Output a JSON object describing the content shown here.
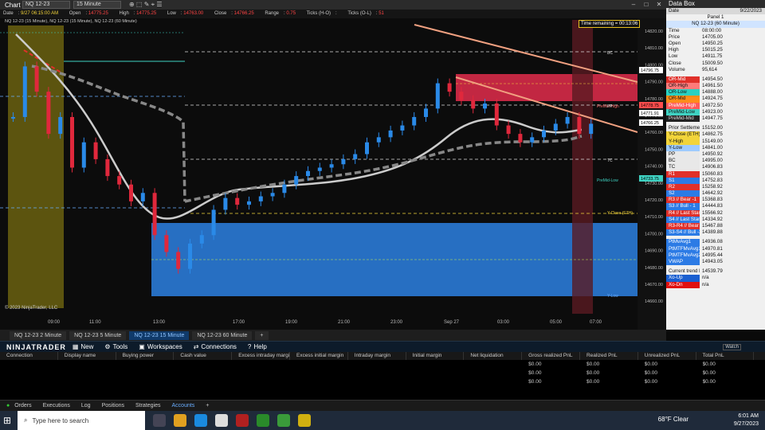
{
  "window": {
    "title": "Chart",
    "instrument": "NQ 12-23",
    "interval": "15 Minute"
  },
  "infobar": {
    "date_label": "Date",
    "date_value": "9/27 06:15:00 AM",
    "open_label": "Open",
    "open_value": "14775.25",
    "high_label": "High",
    "high_value": "14775.25",
    "low_label": "Low",
    "low_value": "14763.00",
    "close_label": "Close",
    "close_value": "14766.25",
    "range_label": "Range",
    "range_value": "0.75",
    "ticks_hl_label": "Ticks (H-O)",
    "ticks_hl_value": "",
    "ticks_ol_label": "Ticks (O-L)",
    "ticks_ol_value": "51"
  },
  "chart": {
    "legend_text": "NQ 12-23 (15 Minute), NQ 12-23 (15 Minute), NQ 12-23 (60 Minute)",
    "time_remaining": "Time remaining = 00:13:06",
    "copyright": "© 2023 NinjaTrader, LLC",
    "y_ticks": [
      "14820.00",
      "14810.00",
      "14800.00",
      "14790.00",
      "14780.00",
      "14770.00",
      "14760.00",
      "14750.00",
      "14740.00",
      "14730.00",
      "14720.00",
      "14710.00",
      "14700.00",
      "14690.00",
      "14680.00",
      "14670.00",
      "14660.00"
    ],
    "x_ticks": [
      "09:00",
      "11:00",
      "13:00",
      "17:00",
      "19:00",
      "21:00",
      "23:00",
      "Sep 27",
      "03:00",
      "05:00",
      "07:00"
    ],
    "price_tags": [
      {
        "value": "14796.75",
        "color": "#ffffff"
      },
      {
        "value": "14778.75",
        "color": "#ff4d4d"
      },
      {
        "value": "14771.91",
        "color": "#ffffff"
      },
      {
        "value": "14766.25",
        "color": "#ffffff"
      },
      {
        "value": "14733.75",
        "color": "#3fd2c2"
      }
    ],
    "level_labels": [
      {
        "text": "BC",
        "color": "#dddddd"
      },
      {
        "text": "PreMid-High",
        "color": "#ff6a6a"
      },
      {
        "text": "PP",
        "color": "#dddddd"
      },
      {
        "text": "TC",
        "color": "#dddddd"
      },
      {
        "text": "PreMid-Low",
        "color": "#3fd2c2"
      },
      {
        "text": "Y-Close (ETH)",
        "color": "#f2d43a"
      },
      {
        "text": "Y-Low",
        "color": "#6aaeff"
      }
    ]
  },
  "chart_data": {
    "type": "candlestick",
    "title": "NQ 12-23 (15 Minute)",
    "ylim": [
      14660,
      14825
    ],
    "xlabel": "",
    "ylabel": "",
    "levels": {
      "BC": 14806.0,
      "PP": 14778.0,
      "TC": 14747.0,
      "Y-Close": 14714.0,
      "PreMid-High": 14778.75,
      "PreMid-Low": 14733.75
    },
    "series": [
      {
        "name": "price",
        "values": [
          14770,
          14800,
          14785,
          14760,
          14770,
          14740,
          14755,
          14745,
          14735,
          14730,
          14720,
          14725,
          14700,
          14690,
          14680,
          14695,
          14700,
          14715,
          14722,
          14718,
          14720,
          14723,
          14725,
          14730,
          14735,
          14738,
          14740,
          14742,
          14745,
          14748,
          14755,
          14758,
          14762,
          14765,
          14770,
          14775,
          14790,
          14785,
          14780,
          14775,
          14778,
          14765,
          14760,
          14755,
          14758,
          14762,
          14766,
          14770,
          14760,
          14766
        ]
      }
    ]
  },
  "tabs": [
    "NQ 12-23 2 Minute",
    "NQ 12-23 5 Minute",
    "NQ 12-23 15 Minute",
    "NQ 12-23 60 Minute",
    "+"
  ],
  "databox": {
    "title": "Data Box",
    "date_label": "Date",
    "date_value": "9/22/2023",
    "panel": "Panel 1",
    "instrument": "NQ 12-23 (60 Minute)",
    "rows": [
      {
        "k": "Time",
        "v": "08:00:00",
        "bg": "#f0f0f0",
        "fg": "#111"
      },
      {
        "k": "Price",
        "v": "14705.00",
        "bg": "#f0f0f0",
        "fg": "#111"
      },
      {
        "k": "Open",
        "v": "14950.25",
        "bg": "#f0f0f0",
        "fg": "#111"
      },
      {
        "k": "High",
        "v": "15015.25",
        "bg": "#f0f0f0",
        "fg": "#111"
      },
      {
        "k": "Low",
        "v": "14911.75",
        "bg": "#f0f0f0",
        "fg": "#111"
      },
      {
        "k": "Close",
        "v": "15009.50",
        "bg": "#f0f0f0",
        "fg": "#111"
      },
      {
        "k": "Volume",
        "v": "95,614",
        "bg": "#f0f0f0",
        "fg": "#111"
      },
      {
        "k": "",
        "v": "",
        "bg": "#f0f0f0",
        "fg": "#111"
      },
      {
        "k": "OR-Mid",
        "v": "14954.50",
        "bg": "#e0302a",
        "fg": "#fff"
      },
      {
        "k": "OR-High",
        "v": "14961.50",
        "bg": "#ff7a7a",
        "fg": "#111"
      },
      {
        "k": "OR-Low",
        "v": "14888.00",
        "bg": "#2ad1c2",
        "fg": "#111"
      },
      {
        "k": "OR-Mid",
        "v": "14924.75",
        "bg": "#ff8c1a",
        "fg": "#111"
      },
      {
        "k": "PreMid-High",
        "v": "14972.50",
        "bg": "#ff5a5a",
        "fg": "#fff"
      },
      {
        "k": "PreMid-Low",
        "v": "14923.00",
        "bg": "#3fd2c2",
        "fg": "#111"
      },
      {
        "k": "PreMid-Mid",
        "v": "14947.75",
        "bg": "#222",
        "fg": "#ddd"
      },
      {
        "k": "",
        "v": "",
        "bg": "#f0f0f0",
        "fg": "#111"
      },
      {
        "k": "Prior Settlement",
        "v": "15152.00",
        "bg": "#e8e8e8",
        "fg": "#111"
      },
      {
        "k": "Y-Close (ETH)",
        "v": "14862.75",
        "bg": "#f2d43a",
        "fg": "#111"
      },
      {
        "k": "Y-High",
        "v": "15149.00",
        "bg": "#f2d43a",
        "fg": "#111"
      },
      {
        "k": "Y-Low",
        "v": "14841.00",
        "bg": "#9ecbff",
        "fg": "#111"
      },
      {
        "k": "PP",
        "v": "14950.92",
        "bg": "#e8e8e8",
        "fg": "#111"
      },
      {
        "k": "BC",
        "v": "14995.00",
        "bg": "#e8e8e8",
        "fg": "#111"
      },
      {
        "k": "TC",
        "v": "14906.83",
        "bg": "#e8e8e8",
        "fg": "#111"
      },
      {
        "k": "R1",
        "v": "15060.83",
        "bg": "#e0302a",
        "fg": "#fff"
      },
      {
        "k": "S1",
        "v": "14752.83",
        "bg": "#2c7be5",
        "fg": "#fff"
      },
      {
        "k": "R2",
        "v": "15258.92",
        "bg": "#e0302a",
        "fg": "#fff"
      },
      {
        "k": "S2",
        "v": "14642.92",
        "bg": "#2c7be5",
        "fg": "#fff"
      },
      {
        "k": "R3 // Bear -1",
        "v": "15368.83",
        "bg": "#e0302a",
        "fg": "#fff"
      },
      {
        "k": "S3 // Bull - 1",
        "v": "14444.83",
        "bg": "#2c7be5",
        "fg": "#fff"
      },
      {
        "k": "R4 // Last Stand",
        "v": "15566.92",
        "bg": "#e0302a",
        "fg": "#fff"
      },
      {
        "k": "S4 // Last Stand",
        "v": "14334.92",
        "bg": "#2c7be5",
        "fg": "#fff"
      },
      {
        "k": "R3-R4 // Bear -2",
        "v": "15467.88",
        "bg": "#e0302a",
        "fg": "#fff"
      },
      {
        "k": "S3-S4 // Bull -2",
        "v": "14389.88",
        "bg": "#2c7be5",
        "fg": "#fff"
      },
      {
        "k": "",
        "v": "",
        "bg": "#f0f0f0",
        "fg": "#111"
      },
      {
        "k": "PtMvAvg1",
        "v": "14936.08",
        "bg": "#2c7be5",
        "fg": "#fff"
      },
      {
        "k": "PtMTFMvAvg1",
        "v": "14970.81",
        "bg": "#2c7be5",
        "fg": "#fff"
      },
      {
        "k": "PtMTFMvAvg2",
        "v": "14995.44",
        "bg": "#2c7be5",
        "fg": "#fff"
      },
      {
        "k": "VWAP",
        "v": "14943.05",
        "bg": "#2c7be5",
        "fg": "#fff"
      },
      {
        "k": "",
        "v": "",
        "bg": "#f0f0f0",
        "fg": "#111"
      },
      {
        "k": "Current trend line",
        "v": "14539.79",
        "bg": "#f0f0f0",
        "fg": "#111"
      },
      {
        "k": "Xo-Up",
        "v": "n/a",
        "bg": "#1a5fd0",
        "fg": "#fff"
      },
      {
        "k": "Xo-Dn",
        "v": "n/a",
        "bg": "#e01010",
        "fg": "#fff"
      }
    ]
  },
  "control_center": {
    "logo": "NINJATRADER",
    "menu": [
      "New",
      "Tools",
      "Workspaces",
      "Connections",
      "Help"
    ],
    "watch": "Watch"
  },
  "accounts": {
    "headers": [
      "Connection",
      "Display name",
      "Buying power",
      "Cash value",
      "Excess intraday margin",
      "Excess initial margin",
      "Intraday margin",
      "Initial margin",
      "Net liquidation",
      "Gross realized PnL",
      "Realized PnL",
      "Unrealized PnL",
      "Total PnL"
    ],
    "rows": [
      [
        "",
        "",
        "",
        "",
        "",
        "",
        "",
        "",
        "",
        "$0.00",
        "$0.00",
        "$0.00",
        "$0.00"
      ],
      [
        "",
        "",
        "",
        "",
        "",
        "",
        "",
        "",
        "",
        "$0.00",
        "$0.00",
        "$0.00",
        "$0.00"
      ],
      [
        "",
        "",
        "",
        "",
        "",
        "",
        "",
        "",
        "",
        "$0.00",
        "$0.00",
        "$0.00",
        "$0.00"
      ]
    ]
  },
  "bottom_tabs": [
    "Orders",
    "Executions",
    "Log",
    "Positions",
    "Strategies",
    "Accounts",
    "+"
  ],
  "taskbar": {
    "search_placeholder": "Type here to search",
    "weather": "68°F  Clear",
    "time": "6:01 AM",
    "date": "9/27/2023"
  }
}
